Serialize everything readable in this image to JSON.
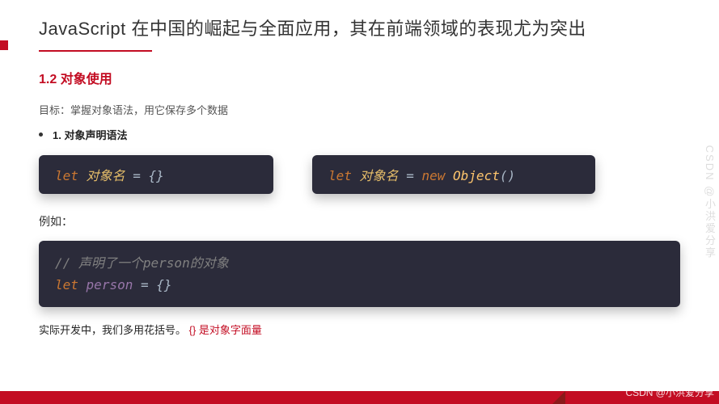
{
  "header": {
    "title": "JavaScript 在中国的崛起与全面应用，其在前端领域的表现尤为突出"
  },
  "section": {
    "heading": "1.2 对象使用",
    "goal": "目标：掌握对象语法，用它保存多个数据",
    "bullet": "1. 对象声明语法"
  },
  "code1": {
    "kw": "let",
    "var": "对象名",
    "op": "=",
    "brace": "{}"
  },
  "code2": {
    "kw": "let",
    "var": "对象名",
    "op": "=",
    "new": "new",
    "type": "Object",
    "paren": "()"
  },
  "exampleLabel": "例如：",
  "code3": {
    "comment": "// 声明了一个person的对象",
    "kw": "let",
    "var": "person",
    "op": "=",
    "brace": "{}"
  },
  "note": {
    "prefix": "实际开发中，我们多用花括号。",
    "red": "{} 是对象字面量"
  },
  "watermark": "CSDN @小洪爱分享",
  "watermarkSide": "CSDN @小洪爱分享"
}
